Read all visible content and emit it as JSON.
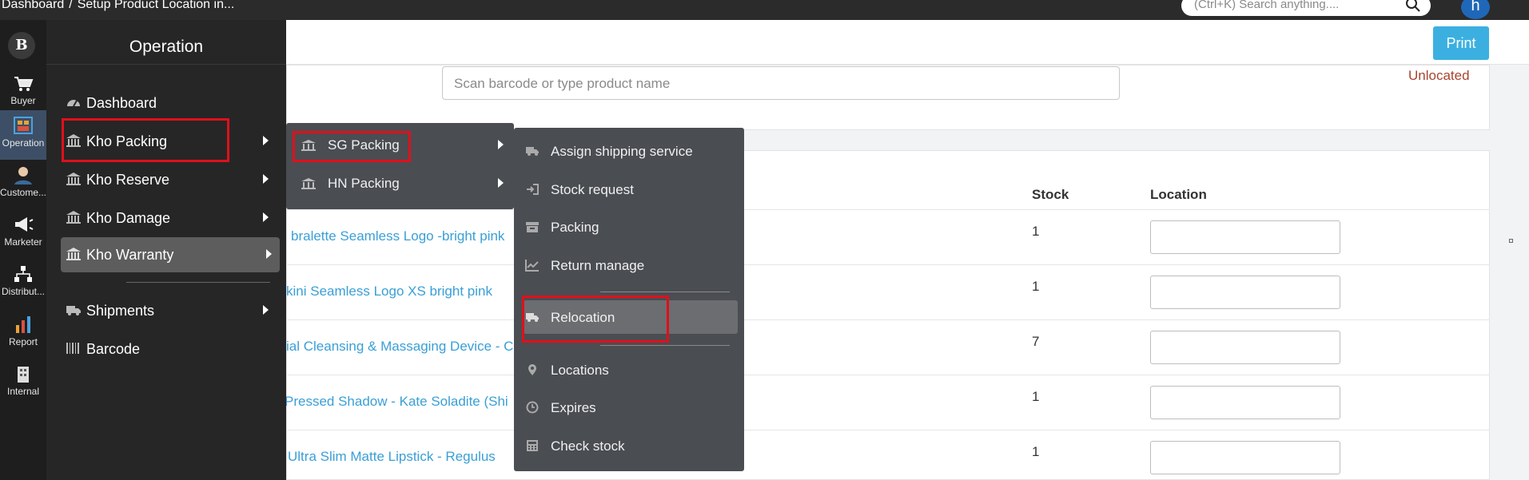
{
  "breadcrumb": {
    "home": "Dashboard",
    "separator": "/",
    "current": "Setup Product Location in..."
  },
  "search": {
    "placeholder": "(Ctrl+K) Search anything...."
  },
  "user": {
    "initial": "h"
  },
  "rail": {
    "logo": "B",
    "items": [
      {
        "label": "Buyer",
        "icon": "cart-icon"
      },
      {
        "label": "Operation",
        "icon": "warehouse-icon",
        "active": true
      },
      {
        "label": "Custome...",
        "icon": "customer-icon"
      },
      {
        "label": "Marketer",
        "icon": "megaphone-icon"
      },
      {
        "label": "Distribut...",
        "icon": "network-icon"
      },
      {
        "label": "Report",
        "icon": "chart-icon"
      },
      {
        "label": "Internal",
        "icon": "building-icon"
      }
    ]
  },
  "operation_menu": {
    "title": "Operation",
    "items": [
      {
        "label": "Dashboard",
        "icon": "dashboard-icon"
      },
      {
        "label": "Kho Packing",
        "icon": "bank-icon",
        "submenu": true
      },
      {
        "label": "Kho Reserve",
        "icon": "bank-icon",
        "submenu": true
      },
      {
        "label": "Kho Damage",
        "icon": "bank-icon",
        "submenu": true
      },
      {
        "label": "Kho Warranty",
        "icon": "bank-icon",
        "submenu": true
      },
      {
        "label": "Shipments",
        "icon": "truck-icon",
        "submenu": true
      },
      {
        "label": "Barcode",
        "icon": "barcode-icon"
      }
    ]
  },
  "packing_submenu": {
    "items": [
      {
        "label": "SG Packing",
        "icon": "bank-icon"
      },
      {
        "label": "HN Packing",
        "icon": "bank-icon"
      }
    ]
  },
  "actions_submenu": {
    "items": [
      {
        "label": "Assign shipping service",
        "icon": "truck-icon"
      },
      {
        "label": "Stock request",
        "icon": "sign-in-icon"
      },
      {
        "label": "Packing",
        "icon": "archive-icon"
      },
      {
        "label": "Return manage",
        "icon": "line-chart-icon"
      },
      {
        "label": "Relocation",
        "icon": "truck-icon"
      },
      {
        "label": "Locations",
        "icon": "map-marker-icon"
      },
      {
        "label": "Expires",
        "icon": "clock-icon"
      },
      {
        "label": "Check stock",
        "icon": "calculator-icon"
      }
    ]
  },
  "toolbar": {
    "print_label": "Print"
  },
  "scan": {
    "placeholder": "Scan barcode or type product name"
  },
  "status": {
    "unlocated": "Unlocated"
  },
  "table": {
    "headers": {
      "stock": "Stock",
      "location": "Location"
    },
    "rows": [
      {
        "product": "bralette Seamless Logo -bright pink",
        "stock": "1"
      },
      {
        "product": "kini Seamless Logo XS bright pink",
        "stock": "1"
      },
      {
        "product": "ial Cleansing & Massaging Device - C",
        "stock": "7"
      },
      {
        "product": "Pressed Shadow - Kate Soladite (Shi",
        "stock": "1"
      },
      {
        "product": "Ultra Slim Matte Lipstick - Regulus",
        "stock": "1"
      }
    ]
  },
  "colors": {
    "accent": "#3bb0e0",
    "highlight_box": "#e0101b",
    "link": "#3a9fd6",
    "unlocated": "#a8452f"
  }
}
